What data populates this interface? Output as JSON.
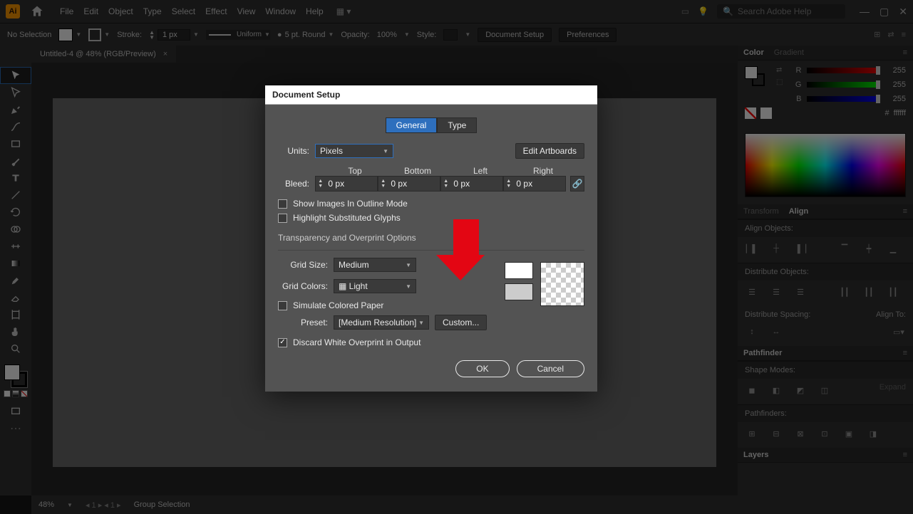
{
  "menu": {
    "items": [
      "File",
      "Edit",
      "Object",
      "Type",
      "Select",
      "Effect",
      "View",
      "Window",
      "Help"
    ],
    "search_placeholder": "Search Adobe Help"
  },
  "control": {
    "selection": "No Selection",
    "stroke_label": "Stroke:",
    "stroke_val": "1 px",
    "profile": "Uniform",
    "brush": "5 pt. Round",
    "opacity_label": "Opacity:",
    "opacity_val": "100%",
    "style_label": "Style:",
    "doc_setup": "Document Setup",
    "prefs": "Preferences"
  },
  "tab": {
    "title": "Untitled-4 @ 48% (RGB/Preview)"
  },
  "status": {
    "zoom": "48%",
    "tool": "Group Selection"
  },
  "color": {
    "tab_a": "Color",
    "tab_b": "Gradient",
    "r": "255",
    "g": "255",
    "b": "255",
    "hex_label": "#",
    "hex": "ffffff"
  },
  "align": {
    "tab_a": "Transform",
    "tab_b": "Align",
    "sec1": "Align Objects:",
    "sec2": "Distribute Objects:",
    "sec3": "Distribute Spacing:",
    "sec3b": "Align To:"
  },
  "pathfinder": {
    "title": "Pathfinder",
    "sec1": "Shape Modes:",
    "expand": "Expand",
    "sec2": "Pathfinders:"
  },
  "layers": {
    "title": "Layers"
  },
  "dialog": {
    "title": "Document Setup",
    "tab_general": "General",
    "tab_type": "Type",
    "units_label": "Units:",
    "units_val": "Pixels",
    "edit_artboards": "Edit Artboards",
    "bleed_label": "Bleed:",
    "bleed_hdr": [
      "Top",
      "Bottom",
      "Left",
      "Right"
    ],
    "bleed_vals": [
      "0 px",
      "0 px",
      "0 px",
      "0 px"
    ],
    "chk_outline": "Show Images In Outline Mode",
    "chk_glyphs": "Highlight Substituted Glyphs",
    "section_trans": "Transparency and Overprint Options",
    "grid_size_label": "Grid Size:",
    "grid_size_val": "Medium",
    "grid_colors_label": "Grid Colors:",
    "grid_colors_val": "Light",
    "chk_sim": "Simulate Colored Paper",
    "preset_label": "Preset:",
    "preset_val": "[Medium Resolution]",
    "custom": "Custom...",
    "chk_discard": "Discard White Overprint in Output",
    "ok": "OK",
    "cancel": "Cancel"
  }
}
